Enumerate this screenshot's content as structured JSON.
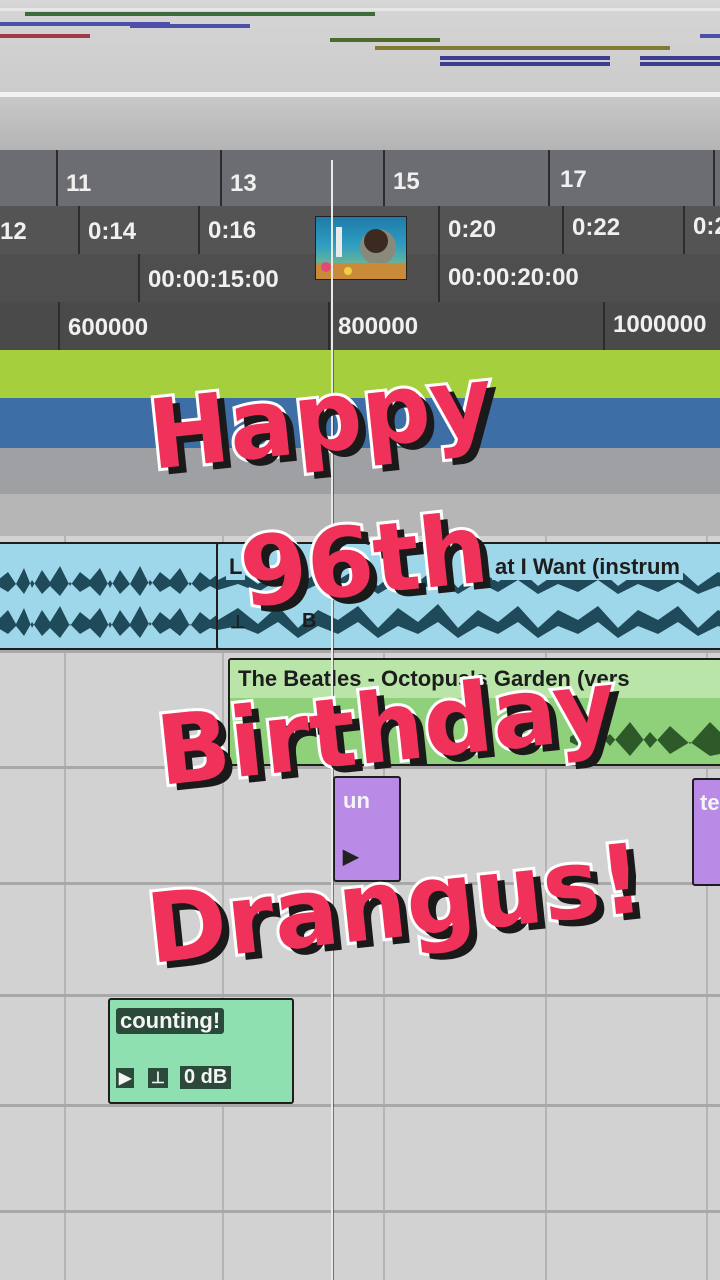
{
  "ruler": {
    "bars": [
      "11",
      "13",
      "15",
      "17"
    ],
    "minsecs": [
      "12",
      "0:14",
      "0:16",
      "0:20",
      "0:22",
      "0:2"
    ],
    "timecode": [
      "00:00:15:00",
      "00:00:20:00"
    ],
    "samples": [
      "600000",
      "800000",
      "1000000"
    ]
  },
  "clips": {
    "track1_left_label": "L",
    "track1_title": "at I Want (instrum",
    "track1_fader_label": "B",
    "track2_title": "The Beatles - Octopus's Garden (vers",
    "track3_clip_a": "un",
    "track3_clip_b": "te",
    "counting_title": "counting!",
    "counting_gain": "0 dB"
  },
  "overlay": {
    "line1": "Happy",
    "line2": "96th",
    "line3": "Birthday",
    "line4": "Drangus!"
  },
  "colors": {
    "overlay_text": "#f0325a",
    "audio_clip_blue": "#9fd7ea",
    "audio_clip_green": "#8fd07a",
    "midi_clip_purple": "#b98ae6",
    "counting_clip": "#8ee0b0",
    "marker_green": "#a5cf3c",
    "marker_blue": "#3d6ea5"
  }
}
